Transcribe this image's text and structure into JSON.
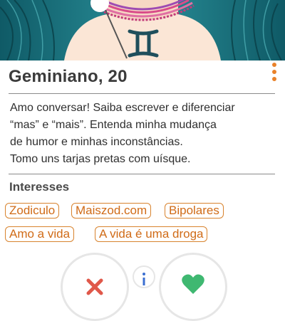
{
  "profile": {
    "name_age": "Geminiano, 20",
    "bio_lines": [
      "Amo conversar! Saiba escrever e diferenciar",
      "“mas” e “mais”. Entenda minha mudança",
      "de humor e minhas inconstâncias.",
      "Tomo uns tarjas pretas com uísque."
    ]
  },
  "interests": {
    "title": "Interesses",
    "tags": [
      "Zodiculo",
      "Maiszod.com",
      "Bipolares",
      "Amo a vida",
      "A vida é uma droga"
    ]
  },
  "icons": {
    "menu": "more-vertical-icon",
    "dislike": "close-x-icon",
    "super": "info-icon",
    "like": "heart-icon"
  },
  "colors": {
    "accent": "#e9822a",
    "tag_border": "#d8832e",
    "dislike": "#e0584a",
    "like": "#3fb871"
  }
}
